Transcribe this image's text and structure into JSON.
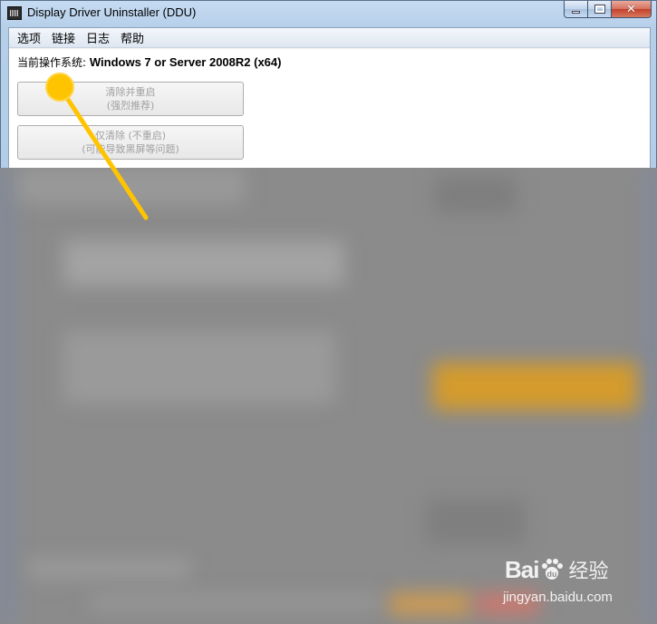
{
  "window": {
    "title": "Display Driver Uninstaller (DDU)",
    "icon": "ddu-app-icon",
    "caption_buttons": [
      "minimize",
      "maximize",
      "close"
    ]
  },
  "menu": {
    "items": [
      {
        "label": "选项"
      },
      {
        "label": "链接"
      },
      {
        "label": "日志"
      },
      {
        "label": "帮助"
      }
    ]
  },
  "os_info": {
    "label": "当前操作系统:",
    "value": "Windows 7 or Server 2008R2 (x64)"
  },
  "buttons": [
    {
      "line1": "清除并重启",
      "line2": "(强烈推荐)",
      "enabled": false
    },
    {
      "line1": "仅清除 (不重启)",
      "line2": "(可能导致黑屏等问题)",
      "enabled": false
    }
  ],
  "watermark": {
    "logo_text": "Bai",
    "logo_cn": "经验",
    "url": "jingyan.baidu.com"
  },
  "colors": {
    "highlight_marker": "#ffc400",
    "overlay": "#8b8b8b",
    "orange_blur": "#d49b2c"
  }
}
